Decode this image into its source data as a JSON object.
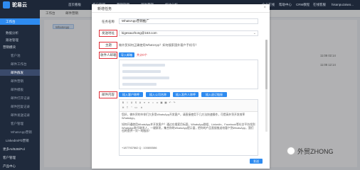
{
  "app": {
    "name": "驼易云"
  },
  "top_menu": [
    {
      "label": "首页看板"
    },
    {
      "label": "客户管理"
    },
    {
      "label": "营销管理"
    },
    {
      "label": "邮件营销"
    },
    {
      "label": "统计分析"
    }
  ],
  "top_right": [
    "企业在线",
    "帮助中心",
    "CRM教程",
    "在线客服",
    "hisanpuzaiwo..."
  ],
  "sidebar": {
    "items": [
      {
        "label": "工作台"
      },
      {
        "label": "数据分析"
      },
      {
        "label": "跟进管理"
      },
      {
        "label": "营销模块"
      },
      {
        "label": "客户池"
      },
      {
        "label": "邮件工作台"
      },
      {
        "label": "邮件群发"
      },
      {
        "label": "邮件营销"
      },
      {
        "label": "邮件模板"
      },
      {
        "label": "邮件打开记录"
      },
      {
        "label": "邮件回复记录"
      },
      {
        "label": "邮件发送记录"
      },
      {
        "label": "客户管理"
      },
      {
        "label": "WhatsApp营销"
      },
      {
        "label": "LinkedIn/Fb营销"
      },
      {
        "label": "更多AI/B2B/Pol"
      },
      {
        "label": "客户管理"
      },
      {
        "label": "产品中心"
      }
    ]
  },
  "tabs": [
    {
      "label": "工作台"
    },
    {
      "label": "邮件营销"
    }
  ],
  "background": {
    "filter_label": "WhatsApp",
    "times": [
      "11:08 02:14",
      "11:08 12:14"
    ]
  },
  "modal": {
    "title": "新增任务",
    "close": "×",
    "task_name_label": "任务名称",
    "task_name_value": "WhatsApp营销推广",
    "sender_label": "发送地址",
    "sender_value": "kigesauzhong@163.com",
    "subject_label": "主题",
    "subject_value": "做外贸如何正确使用WhatsApp？如何搜索国外客户手机号？",
    "recipients_label": "收件人邮箱",
    "import_button": "导入邮箱",
    "recipient_count": "共计0个",
    "personalize_label": "邮件内容",
    "personalize_buttons": [
      "插入客户称呼",
      "插入公司名称",
      "插入发件人称呼",
      "插入退订链接"
    ],
    "body_paragraphs": [
      "您好，做外贸的伙伴们大多用WhatsApp开发客户，请直接使用下几方法快速操作，可提高外贸开发效率WhatsApp。",
      "如何开通使用WhatsApp并开发客户？通过在搜索目标国，WhatsApp群组、LinkedIn、Facebook等社交平台找到WhatsApp账号联系人，一键群发，集合你的WhatsApp提示窗，把你的产品直接推送给客户到WhatsApp，我们也将提供一对一的服务！",
      "+1877937862 Q : 100800586"
    ],
    "send_button": "发送"
  },
  "watermark": {
    "text": "外贸ZHONG"
  }
}
